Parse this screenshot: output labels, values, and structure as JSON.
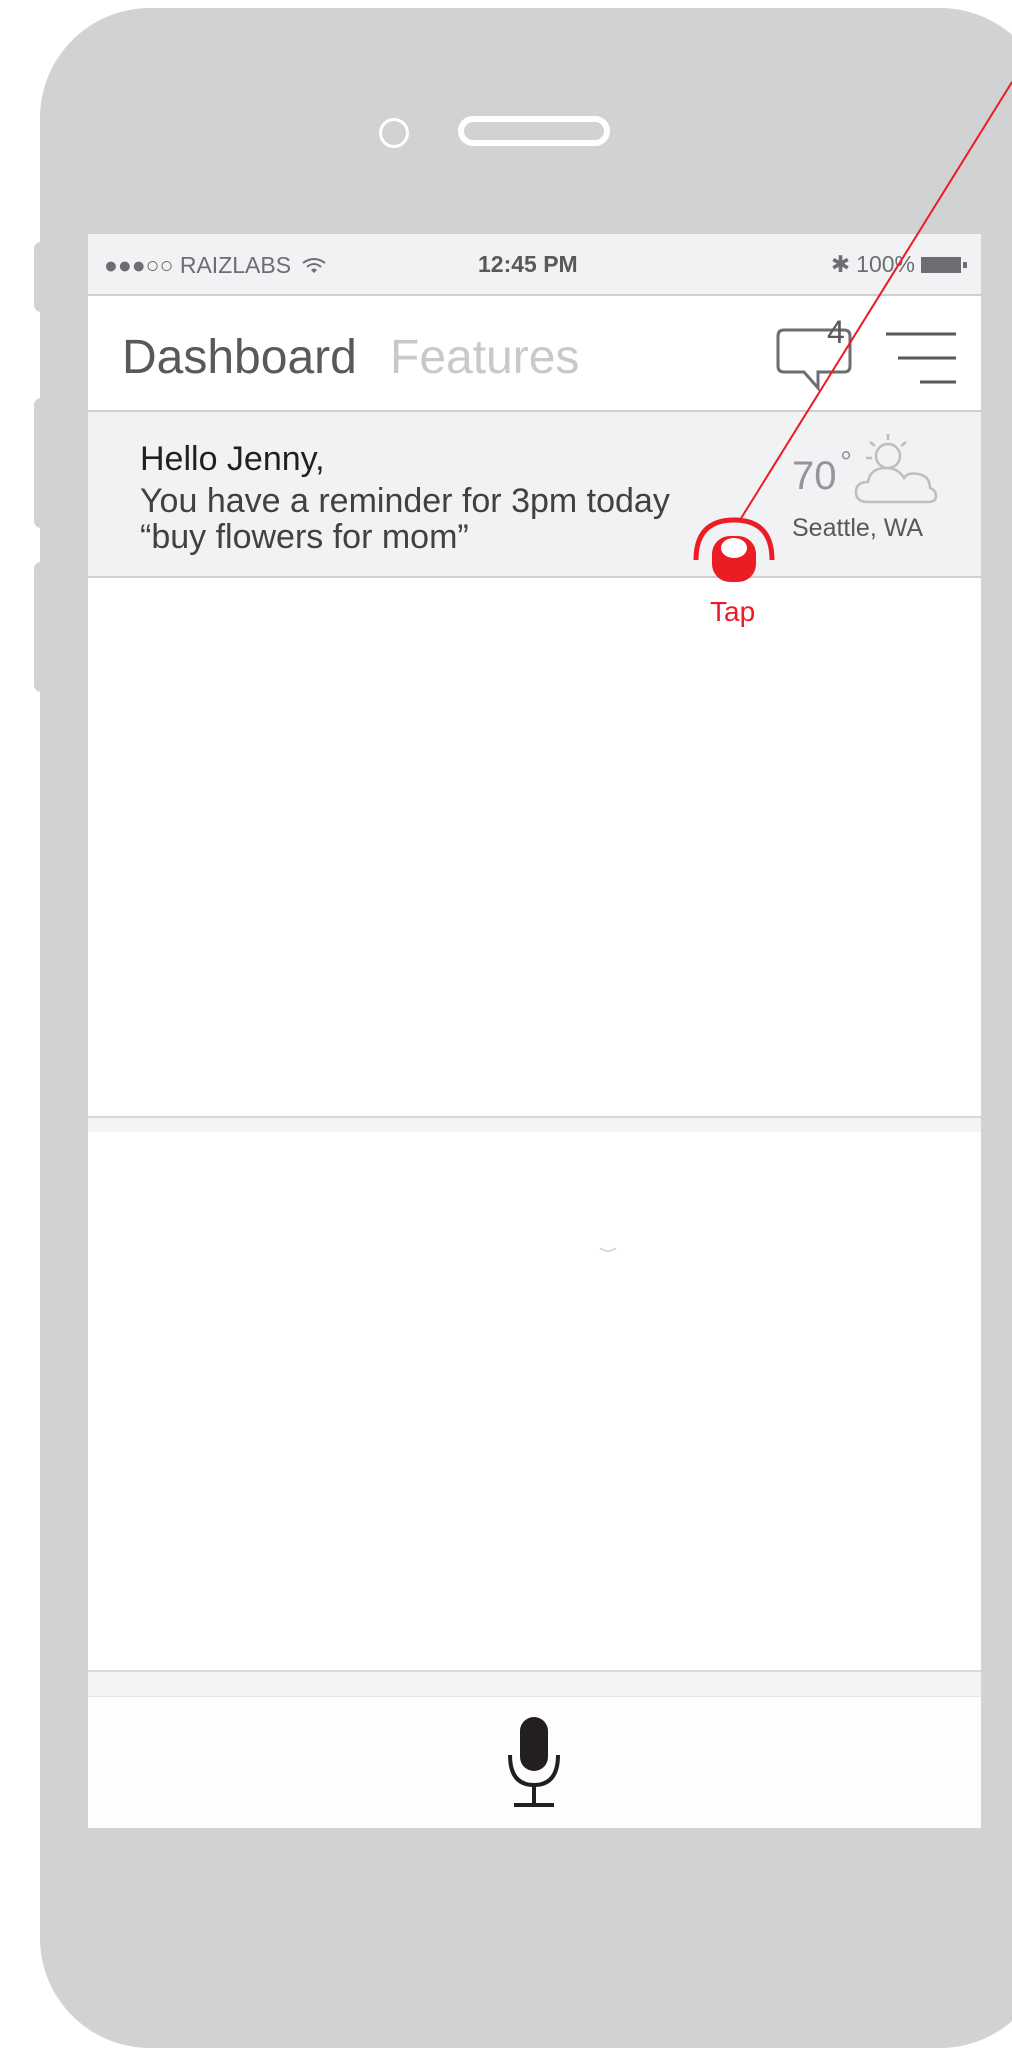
{
  "status_bar": {
    "carrier": "●●●○○ RAIZLABS",
    "wifi_icon": "wifi-icon",
    "time": "12:45 PM",
    "bluetooth": "✱",
    "battery_percent": "100%"
  },
  "nav": {
    "tab_dashboard": "Dashboard",
    "tab_features": "Features",
    "chat_badge": "4",
    "menu_icon": "hamburger-icon"
  },
  "reminder": {
    "greeting": "Hello Jenny,",
    "line1": "You have a reminder for 3pm today",
    "line2": "“buy flowers for mom”"
  },
  "weather": {
    "temperature": "70",
    "degree_symbol": "°",
    "location": "Seattle, WA",
    "icon": "partly-cloudy-icon"
  },
  "annotation": {
    "tap_label": "Tap",
    "color": "#ec1c24"
  },
  "colors": {
    "device": "#d1d2d4",
    "status_bg": "#f1f2f3",
    "accent_red": "#ec1c24"
  }
}
